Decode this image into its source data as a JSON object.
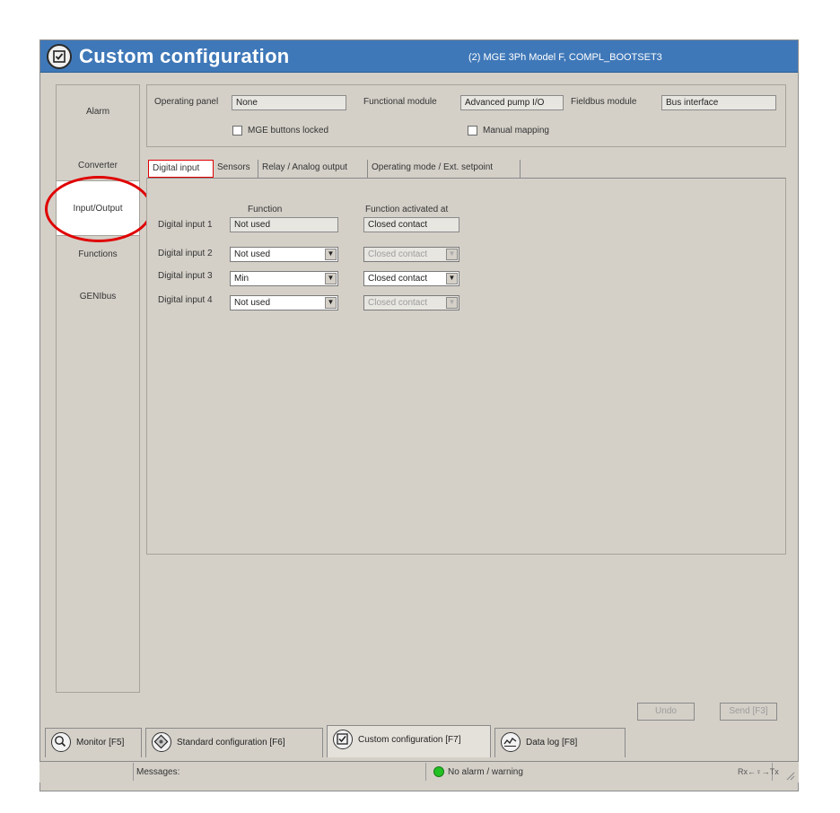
{
  "window": {
    "title": "Custom configuration",
    "device": "(2) MGE 3Ph Model F, COMPL_BOOTSET3"
  },
  "nav": {
    "items": [
      {
        "label": "Alarm"
      },
      {
        "label": "Converter"
      },
      {
        "label": "Input/Output"
      },
      {
        "label": "Functions"
      },
      {
        "label": "GENIbus"
      }
    ],
    "active": "Input/Output"
  },
  "modules": {
    "operating_panel_label": "Operating panel",
    "operating_panel_value": "None",
    "functional_module_label": "Functional module",
    "functional_module_value": "Advanced pump I/O",
    "fieldbus_module_label": "Fieldbus module",
    "fieldbus_module_value": "Bus interface",
    "buttons_locked_label": "MGE buttons locked",
    "manual_mapping_label": "Manual mapping"
  },
  "tabs": [
    {
      "label": "Digital input"
    },
    {
      "label": "Sensors"
    },
    {
      "label": "Relay / Analog output"
    },
    {
      "label": "Operating mode / Ext. setpoint"
    }
  ],
  "digital": {
    "function_header": "Function",
    "activated_header": "Function activated at",
    "rows": [
      {
        "label": "Digital input 1",
        "function": "Not used",
        "activated": "Closed contact"
      },
      {
        "label": "Digital input 2",
        "function": "Not used",
        "activated": "Closed contact"
      },
      {
        "label": "Digital input 3",
        "function": "Min",
        "activated": "Closed contact"
      },
      {
        "label": "Digital input 4",
        "function": "Not used",
        "activated": "Closed contact"
      }
    ]
  },
  "actions": {
    "undo": "Undo",
    "send": "Send [F3]"
  },
  "bottom_tabs": [
    {
      "label": "Monitor [F5]",
      "icon": "magnifier-icon"
    },
    {
      "label": "Standard configuration [F6]",
      "icon": "standard-config-icon"
    },
    {
      "label": "Custom configuration [F7]",
      "icon": "custom-config-icon"
    },
    {
      "label": "Data log [F8]",
      "icon": "data-log-icon"
    }
  ],
  "status": {
    "messages_label": "Messages:",
    "alarm_text": "No alarm / warning",
    "alarm_color": "#22c022",
    "rx_tx": "Rx←♀→Tx"
  },
  "colors": {
    "title_bar": "#3f78b8",
    "highlight": "#e00000"
  }
}
